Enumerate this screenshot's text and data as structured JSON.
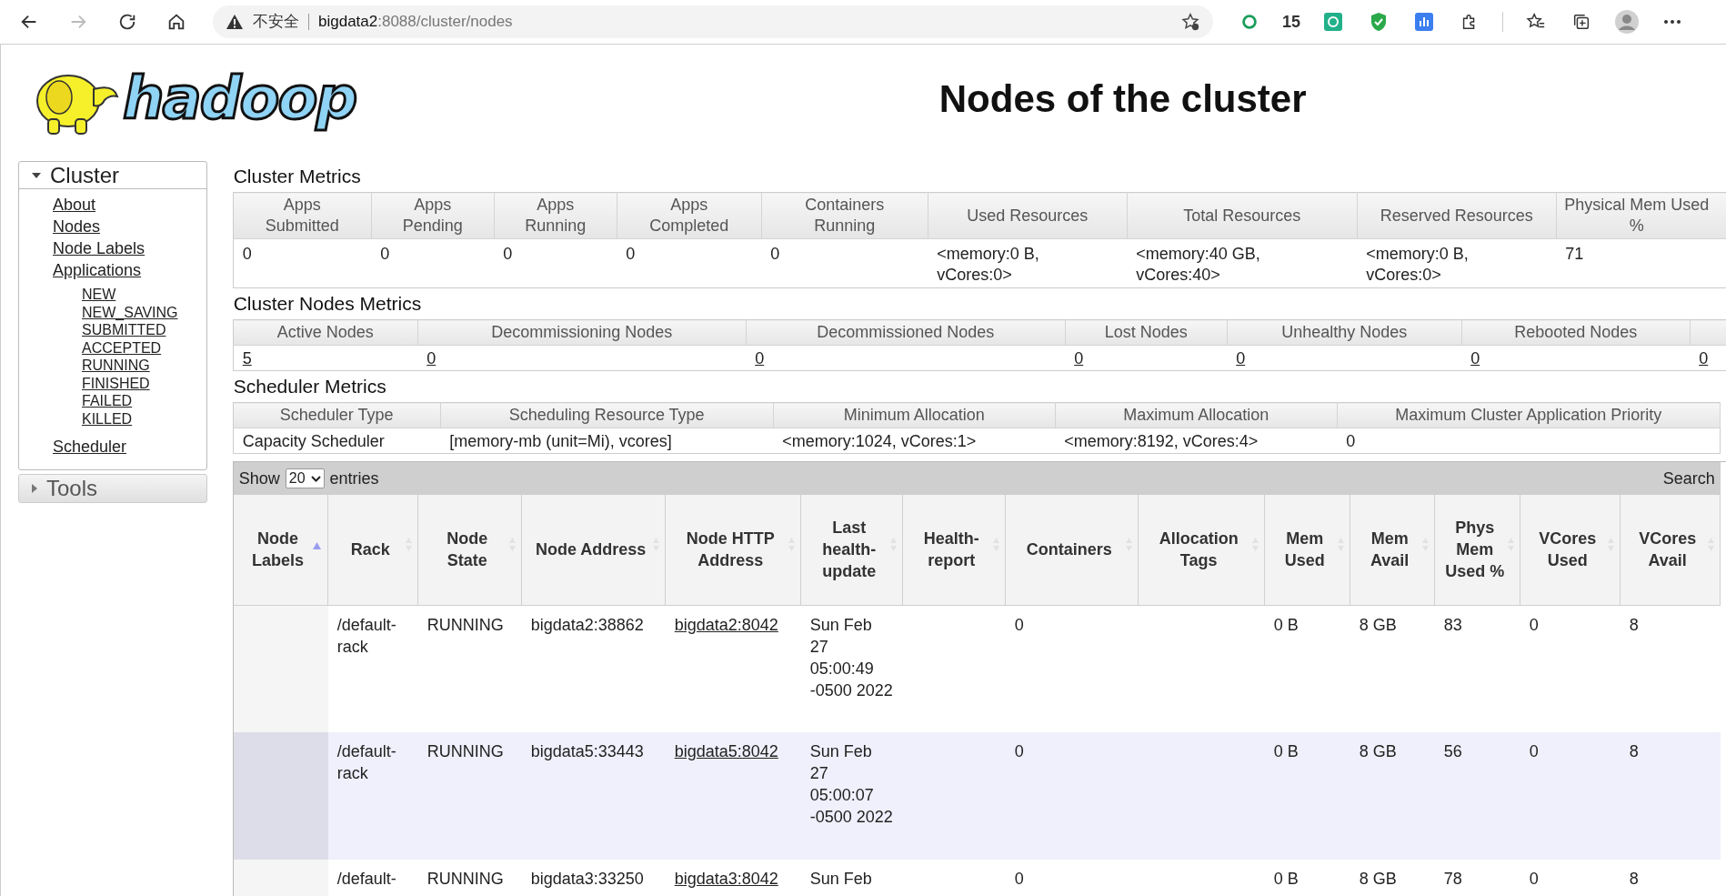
{
  "browser": {
    "security": "不安全",
    "url_host": "bigdata2",
    "url_rest": ":8088/cluster/nodes",
    "extension_count": "15"
  },
  "logo": {
    "text": "hadoop"
  },
  "title": "Nodes of the cluster",
  "sidebar": [
    {
      "label": "Cluster",
      "expanded": true,
      "items": [
        {
          "label": "About"
        },
        {
          "label": "Nodes"
        },
        {
          "label": "Node Labels"
        },
        {
          "label": "Applications",
          "children": [
            {
              "label": "NEW"
            },
            {
              "label": "NEW_SAVING"
            },
            {
              "label": "SUBMITTED"
            },
            {
              "label": "ACCEPTED"
            },
            {
              "label": "RUNNING"
            },
            {
              "label": "FINISHED"
            },
            {
              "label": "FAILED"
            },
            {
              "label": "KILLED"
            }
          ]
        },
        {
          "label": "Scheduler"
        }
      ]
    },
    {
      "label": "Tools",
      "expanded": false
    }
  ],
  "cluster_metrics": {
    "title": "Cluster Metrics",
    "columns": [
      {
        "header": "Apps Submitted",
        "value": "0"
      },
      {
        "header": "Apps Pending",
        "value": "0"
      },
      {
        "header": "Apps Running",
        "value": "0"
      },
      {
        "header": "Apps Completed",
        "value": "0"
      },
      {
        "header": "Containers Running",
        "value": "0"
      },
      {
        "header": "Used Resources",
        "value": "<memory:0 B, vCores:0>"
      },
      {
        "header": "Total Resources",
        "value": "<memory:40 GB, vCores:40>"
      },
      {
        "header": "Reserved Resources",
        "value": "<memory:0 B, vCores:0>"
      },
      {
        "header": "Physical Mem Used %",
        "value": "71"
      }
    ]
  },
  "cluster_nodes_metrics": {
    "title": "Cluster Nodes Metrics",
    "columns": [
      {
        "header": "Active Nodes",
        "value": "5"
      },
      {
        "header": "Decommissioning Nodes",
        "value": "0"
      },
      {
        "header": "Decommissioned Nodes",
        "value": "0"
      },
      {
        "header": "Lost Nodes",
        "value": "0"
      },
      {
        "header": "Unhealthy Nodes",
        "value": "0"
      },
      {
        "header": "Rebooted Nodes",
        "value": "0"
      },
      {
        "value": "0"
      }
    ]
  },
  "scheduler_metrics": {
    "title": "Scheduler Metrics",
    "columns": [
      {
        "header": "Scheduler Type",
        "value": "Capacity Scheduler"
      },
      {
        "header": "Scheduling Resource Type",
        "value": "[memory-mb (unit=Mi), vcores]"
      },
      {
        "header": "Minimum Allocation",
        "value": "<memory:1024, vCores:1>"
      },
      {
        "header": "Maximum Allocation",
        "value": "<memory:8192, vCores:4>"
      },
      {
        "header": "Maximum Cluster Application Priority",
        "value": "0"
      }
    ]
  },
  "nodes_table": {
    "show_label": "Show",
    "page_size": "20",
    "entries_label": "entries",
    "search_label": "Search",
    "columns": [
      {
        "header": "Node Labels",
        "sorted": true
      },
      {
        "header": "Rack",
        "sorted": false
      },
      {
        "header": "Node State",
        "sorted": false
      },
      {
        "header": "Node Address",
        "sorted": false
      },
      {
        "header": "Node HTTP Address",
        "sorted": false
      },
      {
        "header": "Last health-update",
        "sorted": false
      },
      {
        "header": "Health-report",
        "sorted": false
      },
      {
        "header": "Containers",
        "sorted": false
      },
      {
        "header": "Allocation Tags",
        "sorted": false
      },
      {
        "header": "Mem Used",
        "sorted": false
      },
      {
        "header": "Mem Avail",
        "sorted": false
      },
      {
        "header": "Phys Mem Used %",
        "sorted": false
      },
      {
        "header": "VCores Used",
        "sorted": false
      },
      {
        "header": "VCores Avail",
        "sorted": false
      }
    ],
    "rows": [
      [
        "",
        "/default-rack",
        "RUNNING",
        "bigdata2:38862",
        "bigdata2:8042",
        "Sun Feb 27 05:00:49 -0500 2022",
        "",
        "0",
        "",
        "0 B",
        "8 GB",
        "83",
        "0",
        "8"
      ],
      [
        "",
        "/default-rack",
        "RUNNING",
        "bigdata5:33443",
        "bigdata5:8042",
        "Sun Feb 27 05:00:07 -0500 2022",
        "",
        "0",
        "",
        "0 B",
        "8 GB",
        "56",
        "0",
        "8"
      ],
      [
        "",
        "/default-",
        "RUNNING",
        "bigdata3:33250",
        "bigdata3:8042",
        "Sun Feb",
        "",
        "0",
        "",
        "0 B",
        "8 GB",
        "78",
        "0",
        "8"
      ]
    ]
  }
}
